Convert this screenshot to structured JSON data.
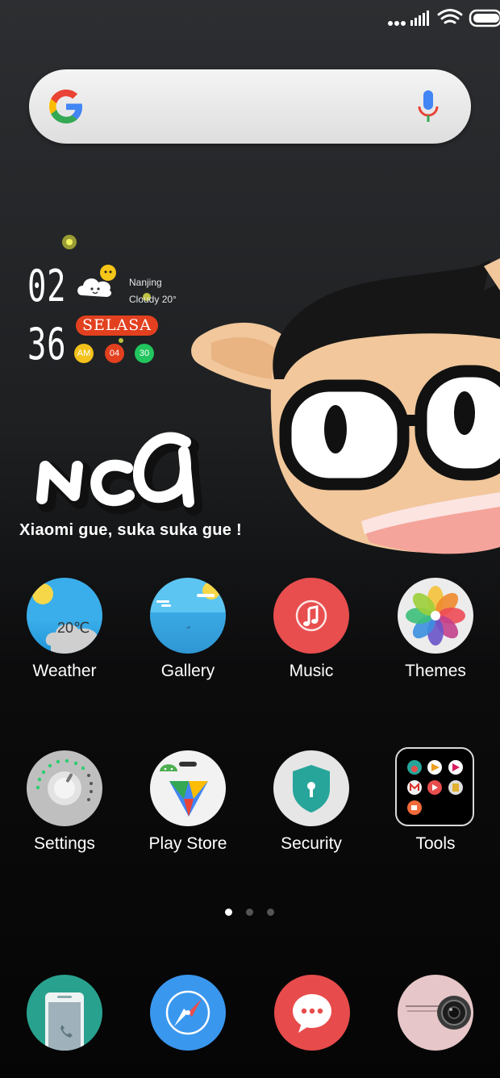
{
  "status_bar": {
    "icons": [
      "ellipsis-icon",
      "signal-icon",
      "wifi-icon",
      "battery-icon"
    ]
  },
  "search_widget": {
    "logo": "google-logo",
    "mic_icon": "microphone-icon"
  },
  "clock_widget": {
    "hour": "02",
    "minute": "36",
    "city": "Nanjing",
    "condition": "Cloudy 20°",
    "day": "SELASA",
    "dots": [
      "AM",
      "04",
      "30"
    ]
  },
  "wallpaper": {
    "tagline": "Xiaomi gue, suka suka gue !"
  },
  "apps": {
    "row1": [
      {
        "label": "Weather",
        "badge": "20℃"
      },
      {
        "label": "Gallery"
      },
      {
        "label": "Music"
      },
      {
        "label": "Themes"
      }
    ],
    "row2": [
      {
        "label": "Settings"
      },
      {
        "label": "Play Store"
      },
      {
        "label": "Security"
      },
      {
        "label": "Tools"
      }
    ]
  },
  "page_indicator": {
    "count": 3,
    "active": 1
  },
  "dock": {
    "icons": [
      "phone-icon",
      "browser-icon",
      "messaging-icon",
      "camera-icon"
    ]
  },
  "colors": {
    "day_pill": "#e2401f",
    "weather_sky": "#42b0ec",
    "music": "#e84e4e",
    "messaging": "#e84b4b",
    "browser": "#3a97ee",
    "phone": "#29a18f",
    "camera": "#e6c6c8"
  }
}
